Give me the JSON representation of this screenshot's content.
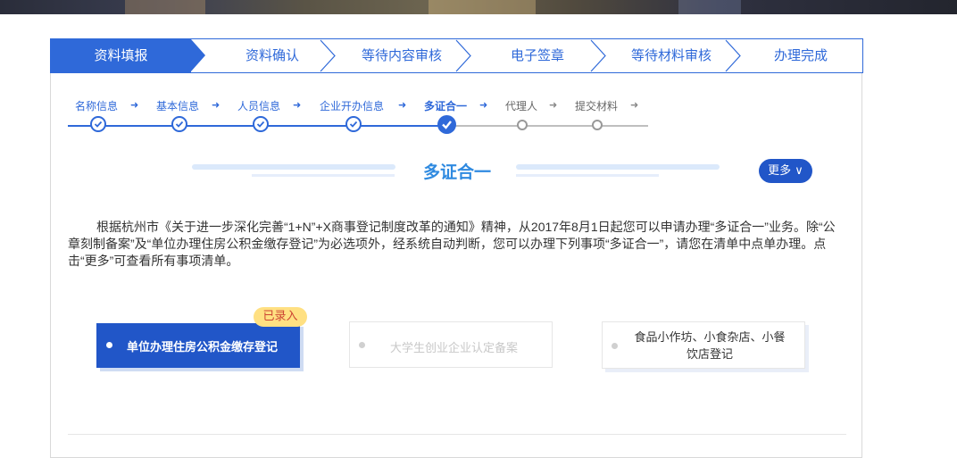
{
  "steps": [
    {
      "label": "资料填报",
      "state": "active"
    },
    {
      "label": "资料确认",
      "state": "todo"
    },
    {
      "label": "等待内容审核",
      "state": "todo"
    },
    {
      "label": "电子签章",
      "state": "todo"
    },
    {
      "label": "等待材料审核",
      "state": "todo"
    },
    {
      "label": "办理完成",
      "state": "todo"
    }
  ],
  "substeps": [
    {
      "label": "名称信息",
      "state": "done"
    },
    {
      "label": "基本信息",
      "state": "done"
    },
    {
      "label": "人员信息",
      "state": "done"
    },
    {
      "label": "企业开办信息",
      "state": "done"
    },
    {
      "label": "多证合一",
      "state": "current"
    },
    {
      "label": "代理人",
      "state": "pending"
    },
    {
      "label": "提交材料",
      "state": "pending"
    }
  ],
  "section": {
    "title": "多证合一",
    "more_label": "更多 ∨"
  },
  "intro_text": "根据杭州市《关于进一步深化完善“1+N”+X商事登记制度改革的通知》精神，从2017年8月1日起您可以申请办理“多证合一”业务。除“公章刻制备案”及“单位办理住房公积金缴存登记”为必选项外，经系统自动判断，您可以办理下列事项“多证合一”，请您在清单中点单办理。点击“更多”可查看所有事项清单。",
  "options": [
    {
      "label": "单位办理住房公积金缴存登记",
      "state": "selected",
      "badge": "已录入"
    },
    {
      "label": "大学生创业企业认定备案",
      "state": "disabled"
    },
    {
      "label": "食品小作坊、小食杂店、小餐饮店登记",
      "state": "normal"
    }
  ],
  "colors": {
    "accent": "#2f69d9",
    "selected": "#2156c8",
    "badge": "#ffe082"
  }
}
